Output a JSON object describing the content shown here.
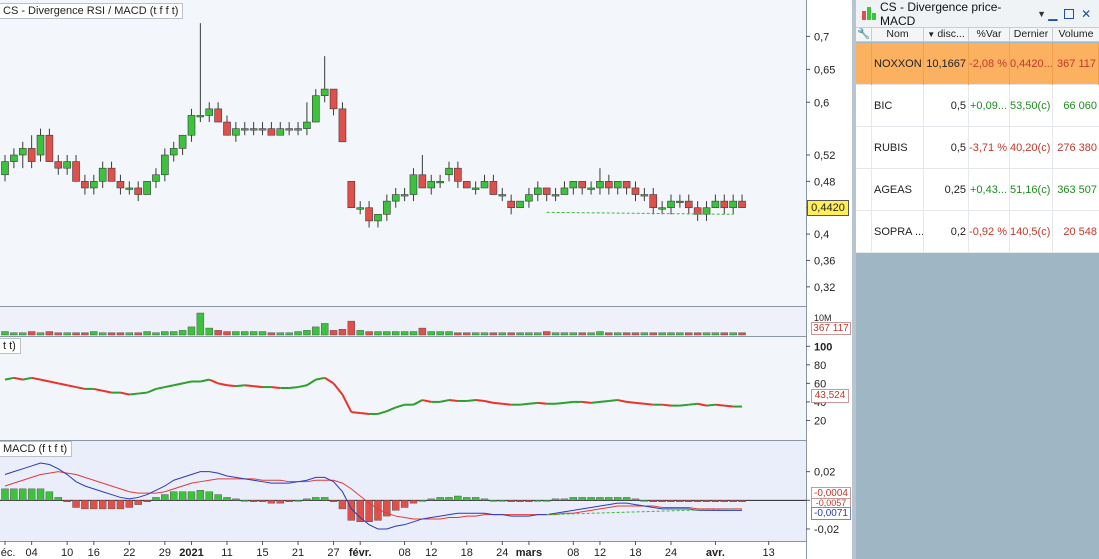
{
  "chart_window": {
    "title": "CS - Divergence RSI / MACD (t f f t)",
    "price_badge": "0,4420",
    "volume_panel": {
      "axis_label": "10M",
      "badge": "367 117"
    },
    "rsi_panel": {
      "title": "t t)",
      "badge": "43,524",
      "ticks": [
        "100",
        "80",
        "60",
        "40",
        "20"
      ]
    },
    "macd_panel": {
      "title": "MACD (f t f t)",
      "badge_signal": "-0,0004",
      "badge_hidden": "-0,0057",
      "badge_macd": "-0,0071",
      "ticks": [
        "0,02",
        "0",
        "-0,02"
      ]
    },
    "price_ticks": [
      "0,7",
      "0,65",
      "0,6",
      "0,52",
      "0,48",
      "0,44",
      "0,4",
      "0,36",
      "0,32"
    ],
    "x_ticks": [
      "déc.",
      "04",
      "10",
      "16",
      "22",
      "29",
      "2021",
      "11",
      "15",
      "21",
      "27",
      "févr.",
      "08",
      "12",
      "18",
      "24",
      "mars",
      "08",
      "12",
      "18",
      "24",
      "avr.",
      "13"
    ]
  },
  "list_window": {
    "title": "CS - Divergence price-MACD",
    "columns": [
      "Nom",
      "disc...",
      "%Var",
      "Dernier",
      "Volume"
    ],
    "rows": [
      {
        "name": "NOXXON",
        "disc": "10,1667",
        "var": "-2,08 %",
        "last": "0,4420...",
        "volume": "367 117",
        "var_dir": "neg",
        "last_dir": "neg",
        "vol_dir": "neg",
        "selected": true
      },
      {
        "name": "BIC",
        "disc": "0,5",
        "var": "+0,09...",
        "last": "53,50(c)",
        "volume": "66 060",
        "var_dir": "pos",
        "last_dir": "pos",
        "vol_dir": "pos",
        "selected": false
      },
      {
        "name": "RUBIS",
        "disc": "0,5",
        "var": "-3,71 %",
        "last": "40,20(c)",
        "volume": "276 380",
        "var_dir": "neg",
        "last_dir": "neg",
        "vol_dir": "neg",
        "selected": false
      },
      {
        "name": "AGEAS",
        "disc": "0,25",
        "var": "+0,43...",
        "last": "51,16(c)",
        "volume": "363 507",
        "var_dir": "pos",
        "last_dir": "pos",
        "vol_dir": "pos",
        "selected": false
      },
      {
        "name": "SOPRA ...",
        "disc": "0,2",
        "var": "-0,92 %",
        "last": "140,5(c)",
        "volume": "20 548",
        "var_dir": "neg",
        "last_dir": "neg",
        "vol_dir": "neg",
        "selected": false
      }
    ]
  },
  "chart_data": {
    "type": "candlestick",
    "colors": {
      "up": "#3cc23c",
      "down": "#e0504a",
      "rsi_up": "#2e9e2e",
      "rsi_down": "#e8332a",
      "macd": "#2a3bb5",
      "signal": "#e23b3b",
      "divergence": "#3cba3c"
    },
    "candles": [
      [
        0.49,
        0.52,
        0.48,
        0.51
      ],
      [
        0.51,
        0.53,
        0.5,
        0.52
      ],
      [
        0.52,
        0.54,
        0.5,
        0.53
      ],
      [
        0.53,
        0.55,
        0.5,
        0.51
      ],
      [
        0.52,
        0.56,
        0.51,
        0.55
      ],
      [
        0.55,
        0.56,
        0.51,
        0.51
      ],
      [
        0.51,
        0.52,
        0.49,
        0.5
      ],
      [
        0.5,
        0.52,
        0.49,
        0.51
      ],
      [
        0.51,
        0.52,
        0.48,
        0.48
      ],
      [
        0.48,
        0.49,
        0.46,
        0.47
      ],
      [
        0.47,
        0.49,
        0.46,
        0.48
      ],
      [
        0.48,
        0.51,
        0.47,
        0.5
      ],
      [
        0.5,
        0.51,
        0.48,
        0.48
      ],
      [
        0.48,
        0.49,
        0.46,
        0.47
      ],
      [
        0.47,
        0.48,
        0.46,
        0.47
      ],
      [
        0.47,
        0.48,
        0.45,
        0.46
      ],
      [
        0.46,
        0.48,
        0.46,
        0.48
      ],
      [
        0.48,
        0.5,
        0.47,
        0.49
      ],
      [
        0.49,
        0.53,
        0.48,
        0.52
      ],
      [
        0.52,
        0.54,
        0.51,
        0.53
      ],
      [
        0.53,
        0.55,
        0.52,
        0.55
      ],
      [
        0.55,
        0.59,
        0.54,
        0.58
      ],
      [
        0.58,
        0.72,
        0.57,
        0.58
      ],
      [
        0.58,
        0.6,
        0.57,
        0.59
      ],
      [
        0.59,
        0.6,
        0.57,
        0.57
      ],
      [
        0.57,
        0.58,
        0.55,
        0.55
      ],
      [
        0.55,
        0.57,
        0.54,
        0.56
      ],
      [
        0.56,
        0.57,
        0.55,
        0.56
      ],
      [
        0.56,
        0.57,
        0.55,
        0.56
      ],
      [
        0.56,
        0.57,
        0.55,
        0.56
      ],
      [
        0.56,
        0.57,
        0.55,
        0.55
      ],
      [
        0.55,
        0.57,
        0.55,
        0.56
      ],
      [
        0.56,
        0.57,
        0.55,
        0.56
      ],
      [
        0.56,
        0.57,
        0.55,
        0.56
      ],
      [
        0.56,
        0.6,
        0.55,
        0.57
      ],
      [
        0.57,
        0.62,
        0.57,
        0.61
      ],
      [
        0.61,
        0.67,
        0.6,
        0.62
      ],
      [
        0.62,
        0.62,
        0.58,
        0.59
      ],
      [
        0.59,
        0.6,
        0.54,
        0.54
      ],
      [
        0.48,
        0.48,
        0.44,
        0.44
      ],
      [
        0.44,
        0.45,
        0.43,
        0.44
      ],
      [
        0.44,
        0.45,
        0.41,
        0.42
      ],
      [
        0.42,
        0.43,
        0.41,
        0.43
      ],
      [
        0.43,
        0.46,
        0.42,
        0.45
      ],
      [
        0.45,
        0.47,
        0.44,
        0.46
      ],
      [
        0.46,
        0.47,
        0.45,
        0.46
      ],
      [
        0.46,
        0.5,
        0.45,
        0.49
      ],
      [
        0.49,
        0.52,
        0.47,
        0.47
      ],
      [
        0.47,
        0.49,
        0.46,
        0.48
      ],
      [
        0.48,
        0.49,
        0.47,
        0.48
      ],
      [
        0.49,
        0.51,
        0.48,
        0.5
      ],
      [
        0.5,
        0.51,
        0.47,
        0.48
      ],
      [
        0.48,
        0.48,
        0.47,
        0.47
      ],
      [
        0.47,
        0.48,
        0.46,
        0.47
      ],
      [
        0.47,
        0.49,
        0.47,
        0.48
      ],
      [
        0.48,
        0.49,
        0.46,
        0.46
      ],
      [
        0.46,
        0.47,
        0.45,
        0.46
      ],
      [
        0.45,
        0.46,
        0.43,
        0.44
      ],
      [
        0.44,
        0.45,
        0.44,
        0.45
      ],
      [
        0.45,
        0.47,
        0.44,
        0.46
      ],
      [
        0.46,
        0.48,
        0.45,
        0.47
      ],
      [
        0.47,
        0.47,
        0.45,
        0.46
      ],
      [
        0.46,
        0.47,
        0.45,
        0.46
      ],
      [
        0.46,
        0.48,
        0.46,
        0.47
      ],
      [
        0.47,
        0.48,
        0.46,
        0.48
      ],
      [
        0.48,
        0.48,
        0.46,
        0.47
      ],
      [
        0.47,
        0.48,
        0.46,
        0.47
      ],
      [
        0.47,
        0.5,
        0.46,
        0.48
      ],
      [
        0.48,
        0.49,
        0.46,
        0.47
      ],
      [
        0.47,
        0.48,
        0.46,
        0.48
      ],
      [
        0.48,
        0.48,
        0.46,
        0.47
      ],
      [
        0.47,
        0.48,
        0.45,
        0.46
      ],
      [
        0.46,
        0.47,
        0.45,
        0.46
      ],
      [
        0.46,
        0.47,
        0.43,
        0.44
      ],
      [
        0.44,
        0.45,
        0.43,
        0.44
      ],
      [
        0.44,
        0.46,
        0.43,
        0.45
      ],
      [
        0.45,
        0.46,
        0.44,
        0.45
      ],
      [
        0.45,
        0.46,
        0.43,
        0.44
      ],
      [
        0.44,
        0.45,
        0.42,
        0.43
      ],
      [
        0.43,
        0.45,
        0.42,
        0.44
      ],
      [
        0.44,
        0.46,
        0.44,
        0.45
      ],
      [
        0.45,
        0.46,
        0.43,
        0.44
      ],
      [
        0.44,
        0.46,
        0.43,
        0.45
      ],
      [
        0.45,
        0.46,
        0.44,
        0.44
      ]
    ],
    "volume": [
      3,
      2,
      2,
      3,
      2,
      3,
      2,
      2,
      2,
      2,
      3,
      2,
      2,
      2,
      2,
      2,
      3,
      2,
      3,
      3,
      4,
      7,
      19,
      6,
      4,
      3,
      3,
      3,
      3,
      3,
      2,
      2,
      2,
      3,
      4,
      7,
      10,
      4,
      5,
      12,
      4,
      3,
      3,
      3,
      3,
      3,
      3,
      6,
      3,
      3,
      3,
      2,
      2,
      2,
      2,
      2,
      2,
      2,
      2,
      2,
      2,
      3,
      2,
      2,
      2,
      2,
      2,
      3,
      2,
      2,
      2,
      2,
      2,
      2,
      2,
      2,
      2,
      2,
      2,
      2,
      2,
      2,
      2,
      2
    ],
    "rsi": [
      64,
      66,
      64,
      66,
      64,
      62,
      60,
      58,
      56,
      54,
      54,
      52,
      50,
      50,
      48,
      49,
      50,
      54,
      56,
      58,
      60,
      62,
      62,
      64,
      60,
      58,
      57,
      58,
      57,
      56,
      56,
      55,
      55,
      56,
      58,
      64,
      66,
      60,
      48,
      29,
      28,
      27,
      27,
      30,
      34,
      37,
      37,
      42,
      40,
      40,
      42,
      41,
      41,
      42,
      41,
      39,
      38,
      37,
      37,
      38,
      39,
      38,
      38,
      39,
      40,
      40,
      39,
      40,
      41,
      42,
      40,
      39,
      38,
      37,
      37,
      36,
      36,
      37,
      38,
      36,
      37,
      36,
      35,
      35
    ],
    "macd": [
      0.018,
      0.02,
      0.022,
      0.024,
      0.026,
      0.025,
      0.022,
      0.018,
      0.013,
      0.01,
      0.008,
      0.006,
      0.004,
      0.002,
      0.001,
      0.002,
      0.004,
      0.007,
      0.01,
      0.014,
      0.016,
      0.018,
      0.02,
      0.02,
      0.019,
      0.017,
      0.016,
      0.015,
      0.014,
      0.013,
      0.012,
      0.012,
      0.012,
      0.013,
      0.014,
      0.016,
      0.016,
      0.013,
      0.006,
      -0.006,
      -0.012,
      -0.017,
      -0.02,
      -0.02,
      -0.018,
      -0.017,
      -0.015,
      -0.013,
      -0.012,
      -0.011,
      -0.01,
      -0.009,
      -0.009,
      -0.009,
      -0.009,
      -0.01,
      -0.01,
      -0.011,
      -0.011,
      -0.011,
      -0.01,
      -0.01,
      -0.009,
      -0.008,
      -0.007,
      -0.006,
      -0.005,
      -0.004,
      -0.003,
      -0.002,
      -0.002,
      -0.003,
      -0.004,
      -0.005,
      -0.006,
      -0.006,
      -0.006,
      -0.006,
      -0.007,
      -0.007,
      -0.007,
      -0.007,
      -0.007,
      -0.007
    ],
    "signal": [
      0.01,
      0.012,
      0.014,
      0.016,
      0.018,
      0.019,
      0.02,
      0.019,
      0.018,
      0.016,
      0.014,
      0.012,
      0.01,
      0.008,
      0.006,
      0.005,
      0.005,
      0.005,
      0.006,
      0.008,
      0.01,
      0.012,
      0.013,
      0.014,
      0.015,
      0.015,
      0.015,
      0.015,
      0.015,
      0.014,
      0.014,
      0.014,
      0.013,
      0.013,
      0.013,
      0.014,
      0.014,
      0.014,
      0.012,
      0.008,
      0.003,
      -0.002,
      -0.006,
      -0.009,
      -0.011,
      -0.012,
      -0.013,
      -0.013,
      -0.013,
      -0.013,
      -0.012,
      -0.012,
      -0.011,
      -0.011,
      -0.01,
      -0.01,
      -0.01,
      -0.01,
      -0.01,
      -0.01,
      -0.01,
      -0.01,
      -0.01,
      -0.009,
      -0.009,
      -0.008,
      -0.007,
      -0.006,
      -0.005,
      -0.004,
      -0.004,
      -0.004,
      -0.004,
      -0.004,
      -0.005,
      -0.005,
      -0.005,
      -0.005,
      -0.006,
      -0.006,
      -0.006,
      -0.006,
      -0.006,
      -0.006
    ],
    "price_ylim": [
      0.3,
      0.74
    ],
    "rsi_ylim": [
      0,
      110
    ],
    "macd_ylim": [
      -0.027,
      0.04
    ],
    "divergence_price": [
      [
        61,
        0.433
      ],
      [
        82,
        0.43
      ]
    ],
    "divergence_macd": [
      [
        61,
        -0.01
      ],
      [
        82,
        -0.006
      ]
    ]
  }
}
